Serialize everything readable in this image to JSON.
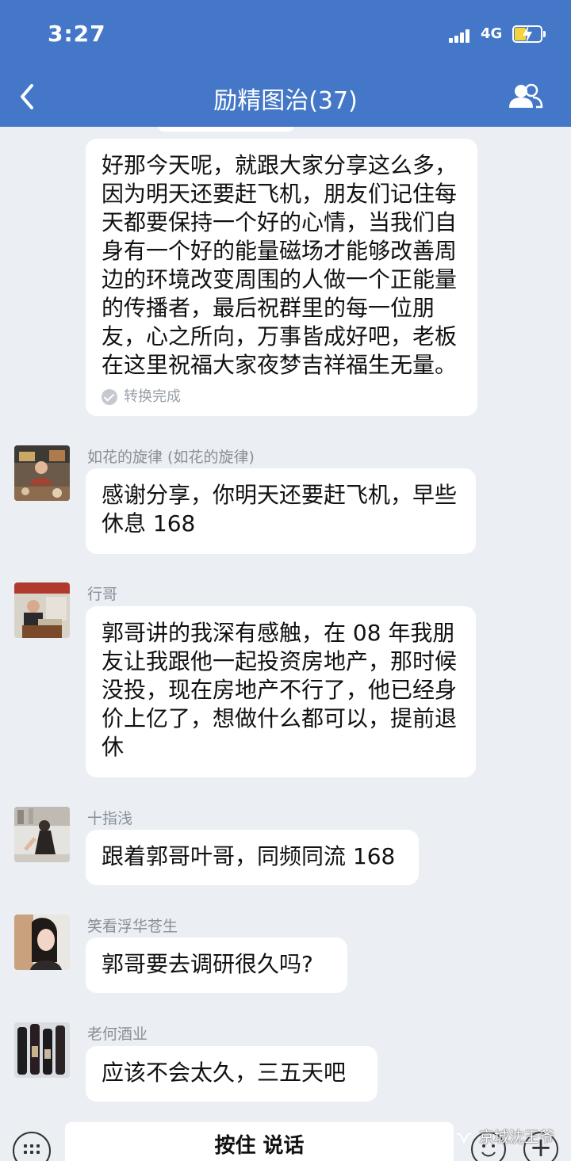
{
  "status_bar": {
    "time": "3:27",
    "network": "4G",
    "battery_level": 0.45,
    "battery_charging": true,
    "battery_color": "#f3d43a"
  },
  "nav": {
    "title": "励精图治(37)",
    "back_icon": "chevron-left-icon",
    "members_icon": "group-members-icon"
  },
  "colors": {
    "header_bg": "#4477c8",
    "chat_bg": "#ebeef3",
    "bubble_bg": "#ffffff",
    "sender_text": "#8a8f98"
  },
  "messages": [
    {
      "sender": "",
      "text": "好那今天呢，就跟大家分享这么多，因为明天还要赶飞机，朋友们记住每天都要保持一个好的心情，当我们自身有一个好的能量磁场才能够改善周边的环境改变周围的人做一个正能量的传播者，最后祝群里的每一位朋友，心之所向，万事皆成好吧，老板在这里祝福大家夜梦吉祥福生无量。",
      "note": "转换完成"
    },
    {
      "sender": "如花的旋律 (如花的旋律)",
      "text": "感谢分享，你明天还要赶飞机，早些休息 168"
    },
    {
      "sender": "行哥",
      "text": "郭哥讲的我深有感触，在 08 年我朋友让我跟他一起投资房地产，那时候没投，现在房地产不行了，他已经身价上亿了，想做什么都可以，提前退休"
    },
    {
      "sender": "十指浅",
      "text": "跟着郭哥叶哥，同频同流 168"
    },
    {
      "sender": "笑看浮华苍生",
      "text": "郭哥要去调研很久吗?"
    },
    {
      "sender": "老何酒业",
      "text": "应该不会太久，三五天吧"
    }
  ],
  "input_bar": {
    "voice_label": "按住 说话",
    "keyboard_icon": "keyboard-icon",
    "emoji_icon": "emoji-icon",
    "plus_icon": "plus-icon"
  },
  "watermark": {
    "text": "京城沈王爷",
    "icon": "wechat-channel-icon"
  }
}
